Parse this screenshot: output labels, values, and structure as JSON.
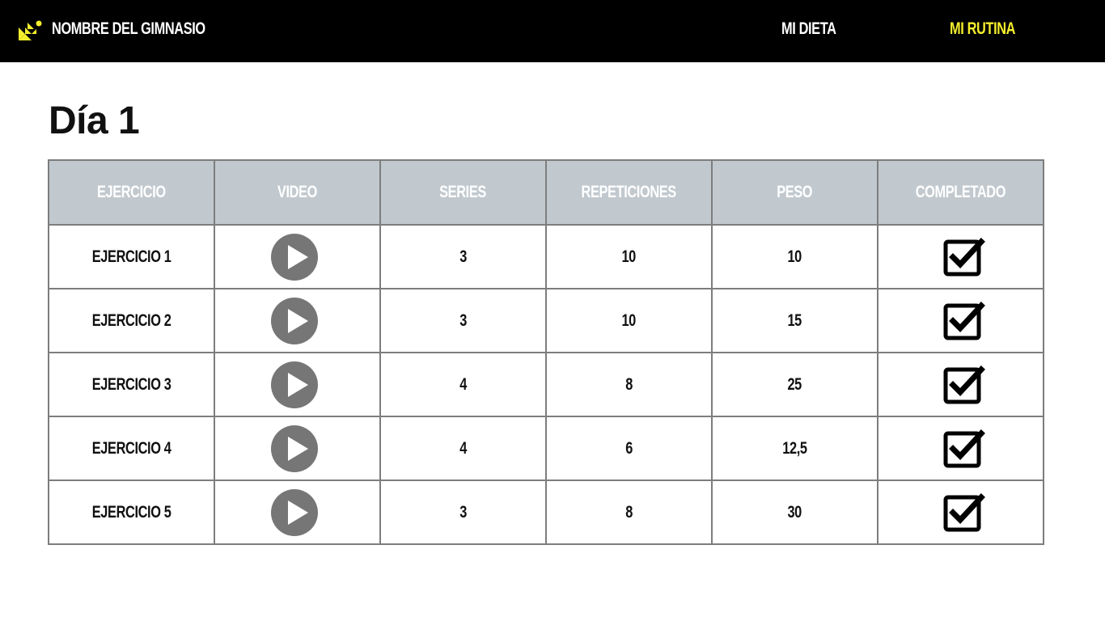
{
  "header": {
    "gym_name": "NOMBRE DEL GIMNASIO",
    "nav": [
      {
        "label": "MI DIETA",
        "active": false
      },
      {
        "label": "MI RUTINA",
        "active": true
      }
    ],
    "logo_icon": "gym-logo-icon",
    "accent_color": "#f4ee2c",
    "background_color": "#000000"
  },
  "main": {
    "day_title": "Día 1",
    "table": {
      "columns": [
        "EJERCICIO",
        "VIDEO",
        "SERIES",
        "REPETICIONES",
        "PESO",
        "COMPLETADO"
      ],
      "header_color": "#c1c9cf",
      "rows": [
        {
          "exercise": "EJERCICIO 1",
          "video_icon": "play-icon",
          "series": "3",
          "reps": "10",
          "weight": "10",
          "completed": true
        },
        {
          "exercise": "EJERCICIO 2",
          "video_icon": "play-icon",
          "series": "3",
          "reps": "10",
          "weight": "15",
          "completed": true
        },
        {
          "exercise": "EJERCICIO 3",
          "video_icon": "play-icon",
          "series": "4",
          "reps": "8",
          "weight": "25",
          "completed": true
        },
        {
          "exercise": "EJERCICIO 4",
          "video_icon": "play-icon",
          "series": "4",
          "reps": "6",
          "weight": "12,5",
          "completed": true
        },
        {
          "exercise": "EJERCICIO 5",
          "video_icon": "play-icon",
          "series": "3",
          "reps": "8",
          "weight": "30",
          "completed": true
        }
      ]
    }
  }
}
